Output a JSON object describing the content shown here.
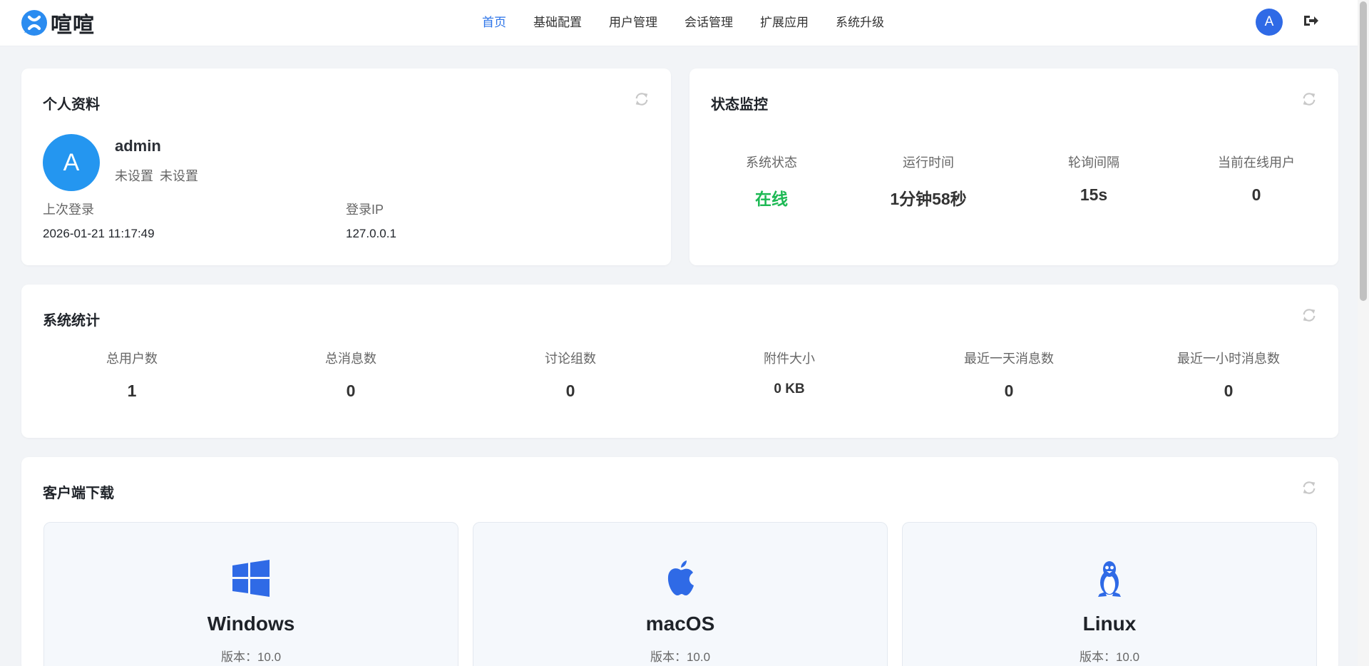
{
  "header": {
    "brand_name": "喧喧",
    "nav": [
      {
        "label": "首页",
        "active": true
      },
      {
        "label": "基础配置",
        "active": false
      },
      {
        "label": "用户管理",
        "active": false
      },
      {
        "label": "会话管理",
        "active": false
      },
      {
        "label": "扩展应用",
        "active": false
      },
      {
        "label": "系统升级",
        "active": false
      }
    ],
    "avatar_letter": "A",
    "accent_color": "#2b73e8"
  },
  "profile": {
    "title": "个人资料",
    "avatar_letter": "A",
    "username": "admin",
    "tag1": "未设置",
    "tag2": "未设置",
    "last_login_label": "上次登录",
    "last_login_value": "2026-01-21 11:17:49",
    "login_ip_label": "登录IP",
    "login_ip_value": "127.0.0.1"
  },
  "status": {
    "title": "状态监控",
    "items": [
      {
        "label": "系统状态",
        "value": "在线",
        "color": "#1db954"
      },
      {
        "label": "运行时间",
        "value": "1分钟58秒"
      },
      {
        "label": "轮询间隔",
        "value": "15s"
      },
      {
        "label": "当前在线用户",
        "value": "0"
      }
    ]
  },
  "stats": {
    "title": "系统统计",
    "items": [
      {
        "label": "总用户数",
        "value": "1"
      },
      {
        "label": "总消息数",
        "value": "0"
      },
      {
        "label": "讨论组数",
        "value": "0"
      },
      {
        "label": "附件大小",
        "value": "0 KB"
      },
      {
        "label": "最近一天消息数",
        "value": "0"
      },
      {
        "label": "最近一小时消息数",
        "value": "0"
      }
    ]
  },
  "downloads": {
    "title": "客户端下载",
    "items": [
      {
        "os": "Windows",
        "version": "版本：10.0",
        "icon": "windows-icon"
      },
      {
        "os": "macOS",
        "version": "版本：10.0",
        "icon": "apple-icon"
      },
      {
        "os": "Linux",
        "version": "版本：10.0",
        "icon": "linux-icon"
      }
    ]
  }
}
